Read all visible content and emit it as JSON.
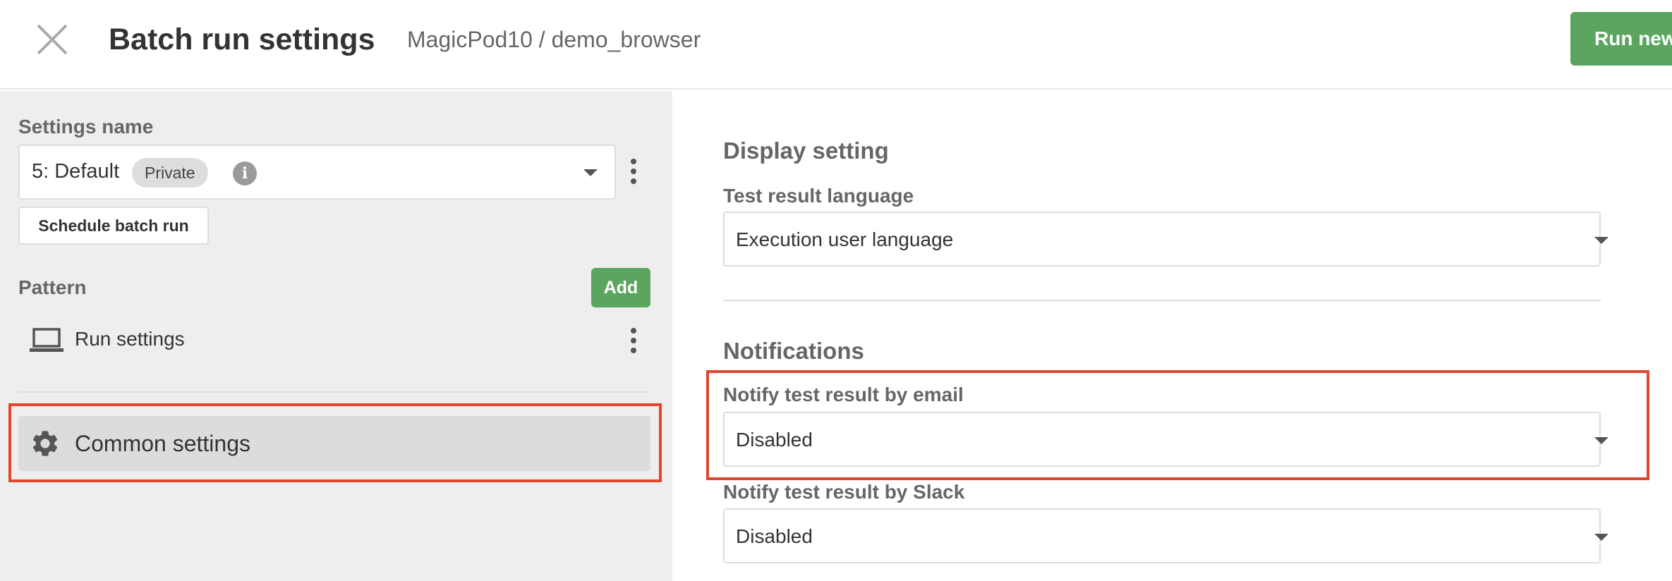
{
  "header": {
    "title": "Batch run settings",
    "breadcrumb": "MagicPod10 / demo_browser",
    "run_button_label": "Run new"
  },
  "sidebar": {
    "settings_name_label": "Settings name",
    "selected_setting": "5: Default",
    "visibility_badge": "Private",
    "schedule_button_label": "Schedule batch run",
    "pattern_label": "Pattern",
    "add_button_label": "Add",
    "patterns": [
      {
        "label": "Run settings",
        "icon": "laptop-icon"
      }
    ],
    "common_settings_label": "Common settings",
    "common_settings_icon": "gear-icon"
  },
  "main": {
    "display_section_title": "Display setting",
    "language_label": "Test result language",
    "language_value": "Execution user language",
    "notifications_section_title": "Notifications",
    "email_label": "Notify test result by email",
    "email_value": "Disabled",
    "slack_label": "Notify test result by Slack",
    "slack_value": "Disabled"
  },
  "colors": {
    "accent_green": "#5ba55f",
    "highlight_red": "#e0462c",
    "panel_gray": "#eeeeee"
  }
}
